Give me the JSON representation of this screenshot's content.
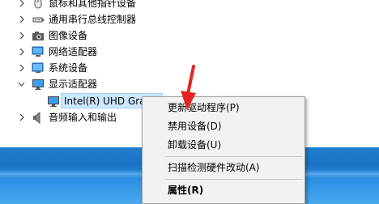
{
  "tree": {
    "items": [
      {
        "label": "鼠标和其他指针设备",
        "icon": "mouse-icon",
        "expanded": false
      },
      {
        "label": "通用串行总线控制器",
        "icon": "usb-icon",
        "expanded": false
      },
      {
        "label": "图像设备",
        "icon": "camera-icon",
        "expanded": false
      },
      {
        "label": "网络适配器",
        "icon": "network-adapter-icon",
        "expanded": false
      },
      {
        "label": "系统设备",
        "icon": "system-device-icon",
        "expanded": false
      },
      {
        "label": "显示适配器",
        "icon": "display-adapter-icon",
        "expanded": true
      },
      {
        "label": "Intel(R) UHD Gra",
        "icon": "display-adapter-icon",
        "child": true,
        "selected": true
      },
      {
        "label": "音频输入和输出",
        "icon": "speaker-icon",
        "expanded": false
      }
    ]
  },
  "context_menu": {
    "update_driver": "更新驱动程序(P)",
    "disable_device": "禁用设备(D)",
    "uninstall_device": "卸载设备(U)",
    "scan_hardware": "扫描检测硬件改动(A)",
    "properties": "属性(R)"
  },
  "colors": {
    "selection": "#cce8ff",
    "menu_bg": "#f2f2f2",
    "arrow": "#e8231f",
    "desktop": "#1a73c6"
  }
}
